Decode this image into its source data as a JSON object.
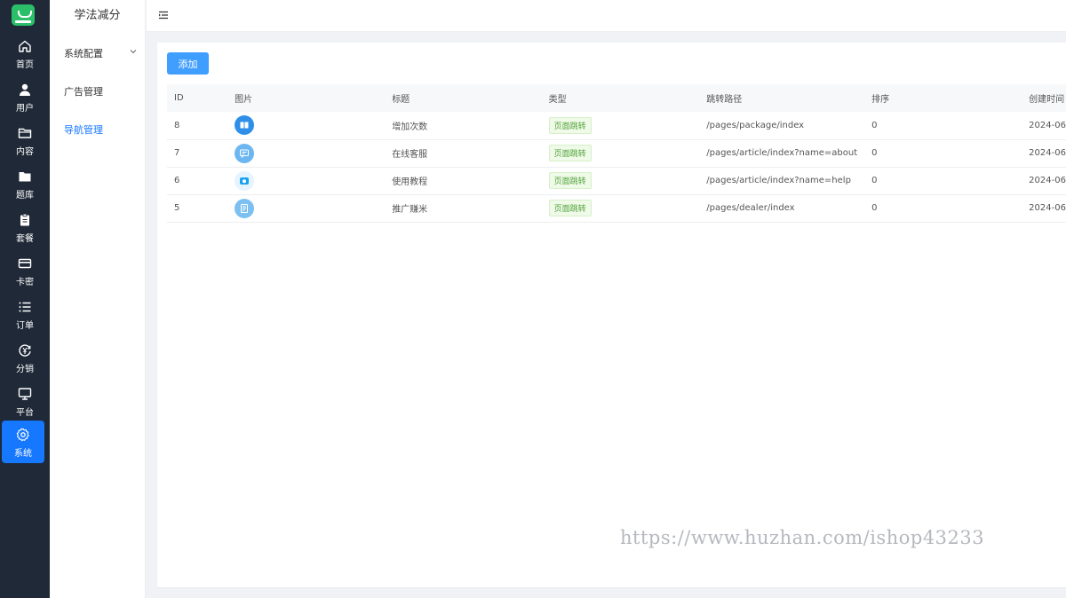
{
  "rail": {
    "items": [
      {
        "label": "首页",
        "icon": "home-icon"
      },
      {
        "label": "用户",
        "icon": "user-icon"
      },
      {
        "label": "内容",
        "icon": "folder-open-icon"
      },
      {
        "label": "题库",
        "icon": "folder-icon"
      },
      {
        "label": "套餐",
        "icon": "clipboard-icon"
      },
      {
        "label": "卡密",
        "icon": "card-icon"
      },
      {
        "label": "订单",
        "icon": "list-icon"
      },
      {
        "label": "分销",
        "icon": "yen-circle-icon"
      },
      {
        "label": "平台",
        "icon": "monitor-icon"
      },
      {
        "label": "系统",
        "icon": "gear-icon"
      }
    ],
    "active": "系统"
  },
  "subnav": {
    "brand": "学法减分",
    "items": [
      {
        "label": "系统配置",
        "has_children": true
      },
      {
        "label": "广告管理"
      },
      {
        "label": "导航管理",
        "active": true
      }
    ]
  },
  "toolbar": {
    "add_label": "添加"
  },
  "table": {
    "columns": [
      "ID",
      "图片",
      "标题",
      "类型",
      "跳转路径",
      "排序",
      "创建时间"
    ],
    "rows": [
      {
        "id": "8",
        "image_icon": "book-icon",
        "title": "增加次数",
        "type": "页面跳转",
        "path": "/pages/package/index",
        "sort": "0",
        "created": "2024-06"
      },
      {
        "id": "7",
        "image_icon": "chat-window-icon",
        "title": "在线客服",
        "type": "页面跳转",
        "path": "/pages/article/index?name=about",
        "sort": "0",
        "created": "2024-06"
      },
      {
        "id": "6",
        "image_icon": "camera-icon",
        "title": "使用教程",
        "type": "页面跳转",
        "path": "/pages/article/index?name=help",
        "sort": "0",
        "created": "2024-06"
      },
      {
        "id": "5",
        "image_icon": "document-icon",
        "title": "推广赚米",
        "type": "页面跳转",
        "path": "/pages/dealer/index",
        "sort": "0",
        "created": "2024-06"
      }
    ]
  },
  "watermark": "https://www.huzhan.com/ishop43233",
  "colors": {
    "rail_bg": "#1f2937",
    "accent": "#1677ff",
    "button": "#409eff",
    "tag_green": "#52a23a"
  }
}
